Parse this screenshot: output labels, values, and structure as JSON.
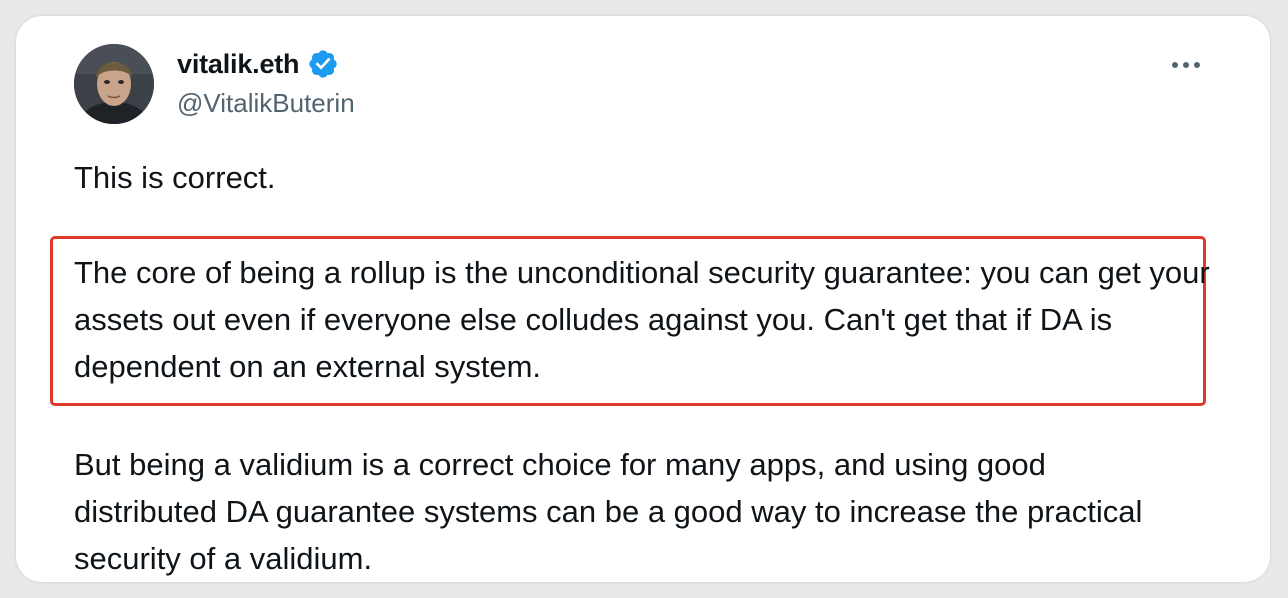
{
  "tweet": {
    "author": {
      "display_name": "vitalik.eth",
      "handle": "@VitalikButerin",
      "verified": true,
      "verified_icon": "verified-badge-icon",
      "verified_color": "#1d9bf0"
    },
    "more_icon": "more-options-icon",
    "paragraphs": [
      "This is correct.",
      "The core of being a rollup is the unconditional security guarantee: you can get your assets out even if everyone else colludes against you. Can't get that if DA is dependent on an external system.",
      "But being a validium is a correct choice for many apps, and using good distributed DA guarantee systems can be a good way to increase the practical security of a validium."
    ],
    "highlight_color": "#e03a2f"
  }
}
